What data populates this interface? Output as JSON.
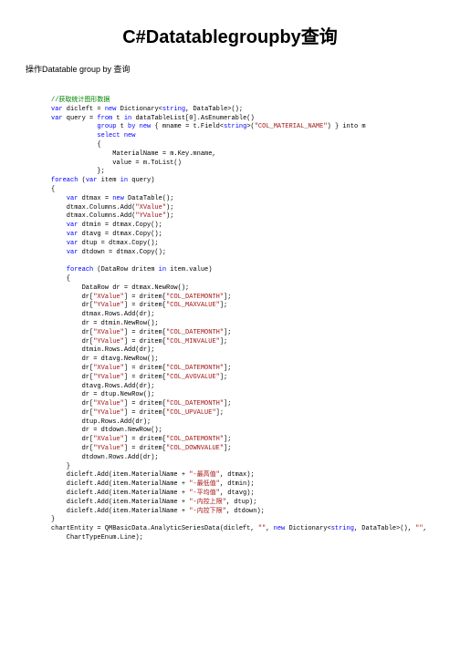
{
  "title": "C#Datatablegroupby查询",
  "intro": "操作Datatable  group by  查询",
  "code": {
    "l01_comment": "//获取统计图形数据",
    "l02a": "var",
    "l02b": " dicleft = ",
    "l02c": "new",
    "l02d": " Dictionary<",
    "l02e": "string",
    "l02f": ", DataTable>();",
    "l03a": "var",
    "l03b": " query = ",
    "l03c": "from",
    "l03d": " t ",
    "l03e": "in",
    "l03f": " dataTableList[0].AsEnumerable()",
    "l04a": "group",
    "l04b": " t ",
    "l04c": "by",
    "l04d": " ",
    "l04e": "new",
    "l04f": " { mname = t.Field<",
    "l04g": "string",
    "l04h": ">(",
    "l04i": "\"COL_MATERIAL_NAME\"",
    "l04j": ") } into m",
    "l05a": "select",
    "l05b": " ",
    "l05c": "new",
    "l06": "            {",
    "l07": "                MaterialName = m.Key.mname,",
    "l08": "                value = m.ToList()",
    "l09": "            };",
    "l10a": "foreach",
    "l10b": " (",
    "l10c": "var",
    "l10d": " item ",
    "l10e": "in",
    "l10f": " query)",
    "l11": "{",
    "l12a": "var",
    "l12b": " dtmax = ",
    "l12c": "new",
    "l12d": " DataTable();",
    "l13a": "    dtmax.Columns.Add(",
    "l13b": "\"XValue\"",
    "l13c": ");",
    "l14a": "    dtmax.Columns.Add(",
    "l14b": "\"YValue\"",
    "l14c": ");",
    "l15a": "var",
    "l15b": " dtmin = dtmax.Copy();",
    "l16a": "var",
    "l16b": " dtavg = dtmax.Copy();",
    "l17a": "var",
    "l17b": " dtup = dtmax.Copy();",
    "l18a": "var",
    "l18b": " dtdown = dtmax.Copy();",
    "blank1": "",
    "l19a": "foreach",
    "l19b": " (DataRow dritem ",
    "l19c": "in",
    "l19d": " item.value)",
    "l20": "    {",
    "l21": "        DataRow dr = dtmax.NewRow();",
    "l22a": "        dr[",
    "l22b": "\"XValue\"",
    "l22c": "] = dritem[",
    "l22d": "\"COL_DATEMONTH\"",
    "l22e": "];",
    "l23a": "        dr[",
    "l23b": "\"YValue\"",
    "l23c": "] = dritem[",
    "l23d": "\"COL_MAXVALUE\"",
    "l23e": "];",
    "l24": "        dtmax.Rows.Add(dr);",
    "l25": "        dr = dtmin.NewRow();",
    "l26a": "        dr[",
    "l26b": "\"XValue\"",
    "l26c": "] = dritem[",
    "l26d": "\"COL_DATEMONTH\"",
    "l26e": "];",
    "l27a": "        dr[",
    "l27b": "\"YValue\"",
    "l27c": "] = dritem[",
    "l27d": "\"COL_MINVALUE\"",
    "l27e": "];",
    "l28": "        dtmin.Rows.Add(dr);",
    "l29": "        dr = dtavg.NewRow();",
    "l30a": "        dr[",
    "l30b": "\"XValue\"",
    "l30c": "] = dritem[",
    "l30d": "\"COL_DATEMONTH\"",
    "l30e": "];",
    "l31a": "        dr[",
    "l31b": "\"YValue\"",
    "l31c": "] = dritem[",
    "l31d": "\"COL_AVGVALUE\"",
    "l31e": "];",
    "l32": "        dtavg.Rows.Add(dr);",
    "l33": "        dr = dtup.NewRow();",
    "l34a": "        dr[",
    "l34b": "\"XValue\"",
    "l34c": "] = dritem[",
    "l34d": "\"COL_DATEMONTH\"",
    "l34e": "];",
    "l35a": "        dr[",
    "l35b": "\"YValue\"",
    "l35c": "] = dritem[",
    "l35d": "\"COL_UPVALUE\"",
    "l35e": "];",
    "l36": "        dtup.Rows.Add(dr);",
    "l37": "        dr = dtdown.NewRow();",
    "l38a": "        dr[",
    "l38b": "\"XValue\"",
    "l38c": "] = dritem[",
    "l38d": "\"COL_DATEMONTH\"",
    "l38e": "];",
    "l39a": "        dr[",
    "l39b": "\"YValue\"",
    "l39c": "] = dritem[",
    "l39d": "\"COL_DOWNVALUE\"",
    "l39e": "];",
    "l40": "        dtdown.Rows.Add(dr);",
    "l41": "    }",
    "l42a": "    dicleft.Add(item.MaterialName + ",
    "l42b": "\"-最高值\"",
    "l42c": ", dtmax);",
    "l43a": "    dicleft.Add(item.MaterialName + ",
    "l43b": "\"-最低值\"",
    "l43c": ", dtmin);",
    "l44a": "    dicleft.Add(item.MaterialName + ",
    "l44b": "\"-平均值\"",
    "l44c": ", dtavg);",
    "l45a": "    dicleft.Add(item.MaterialName + ",
    "l45b": "\"-内控上限\"",
    "l45c": ", dtup);",
    "l46a": "    dicleft.Add(item.MaterialName + ",
    "l46b": "\"-内控下限\"",
    "l46c": ", dtdown);",
    "l47": "}",
    "l48a": "chartEntity = QMBasicData.AnalyticSeriesData(dicleft, ",
    "l48b": "\"\"",
    "l48c": ", ",
    "l48d": "new",
    "l48e": " Dictionary<",
    "l48f": "string",
    "l48g": ", DataTable>(), ",
    "l48h": "\"\"",
    "l48i": ",",
    "l49": "    ChartTypeEnum.Line);"
  }
}
